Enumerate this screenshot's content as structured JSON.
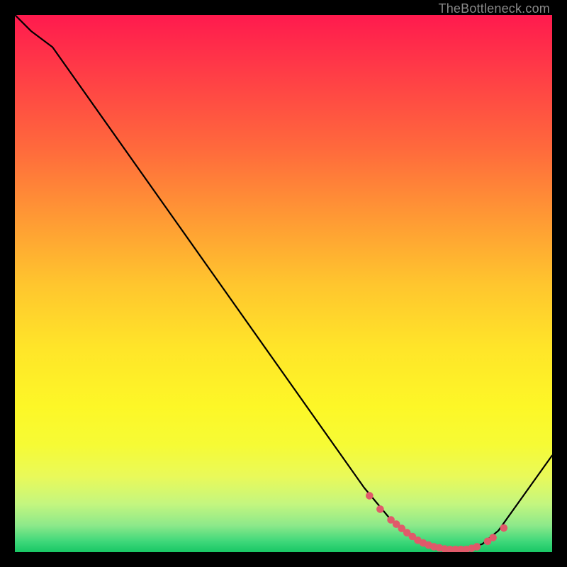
{
  "watermark": "TheBottleneck.com",
  "chart_data": {
    "type": "line",
    "title": "",
    "xlabel": "",
    "ylabel": "",
    "xlim": [
      0,
      100
    ],
    "ylim": [
      0,
      100
    ],
    "series": [
      {
        "name": "curve",
        "x": [
          0,
          3,
          7,
          65,
          70,
          75,
          80,
          84,
          87,
          90,
          100
        ],
        "values": [
          100,
          97,
          94,
          12,
          6,
          2,
          0.5,
          0.5,
          1.5,
          4,
          18
        ]
      }
    ],
    "markers": {
      "name": "highlight-dots",
      "x": [
        66,
        68,
        70,
        71,
        72,
        73,
        74,
        75,
        76,
        77,
        78,
        79,
        80,
        81,
        82,
        83,
        84,
        85,
        86,
        88,
        89,
        91
      ],
      "values": [
        10.5,
        8,
        6,
        5.2,
        4.4,
        3.6,
        2.9,
        2.2,
        1.7,
        1.3,
        1.0,
        0.8,
        0.6,
        0.5,
        0.5,
        0.5,
        0.5,
        0.7,
        1.0,
        2.0,
        2.7,
        4.5
      ]
    },
    "colors": {
      "curve_stroke": "#000000",
      "marker_fill": "#e05a6a"
    }
  }
}
